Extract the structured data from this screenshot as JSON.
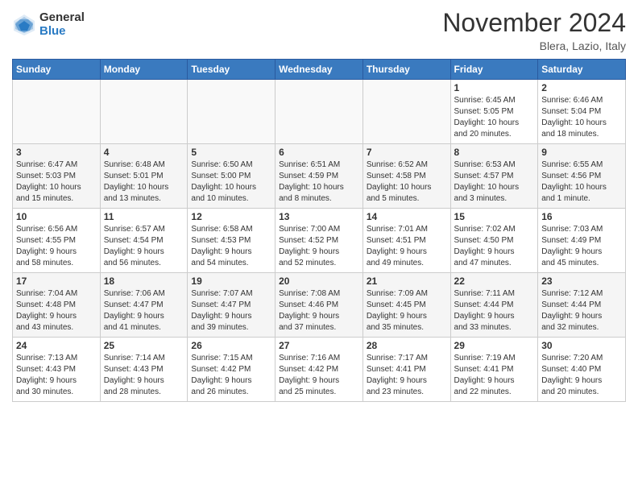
{
  "header": {
    "logo_line1": "General",
    "logo_line2": "Blue",
    "month": "November 2024",
    "location": "Blera, Lazio, Italy"
  },
  "weekdays": [
    "Sunday",
    "Monday",
    "Tuesday",
    "Wednesday",
    "Thursday",
    "Friday",
    "Saturday"
  ],
  "weeks": [
    [
      {
        "day": "",
        "info": ""
      },
      {
        "day": "",
        "info": ""
      },
      {
        "day": "",
        "info": ""
      },
      {
        "day": "",
        "info": ""
      },
      {
        "day": "",
        "info": ""
      },
      {
        "day": "1",
        "info": "Sunrise: 6:45 AM\nSunset: 5:05 PM\nDaylight: 10 hours\nand 20 minutes."
      },
      {
        "day": "2",
        "info": "Sunrise: 6:46 AM\nSunset: 5:04 PM\nDaylight: 10 hours\nand 18 minutes."
      }
    ],
    [
      {
        "day": "3",
        "info": "Sunrise: 6:47 AM\nSunset: 5:03 PM\nDaylight: 10 hours\nand 15 minutes."
      },
      {
        "day": "4",
        "info": "Sunrise: 6:48 AM\nSunset: 5:01 PM\nDaylight: 10 hours\nand 13 minutes."
      },
      {
        "day": "5",
        "info": "Sunrise: 6:50 AM\nSunset: 5:00 PM\nDaylight: 10 hours\nand 10 minutes."
      },
      {
        "day": "6",
        "info": "Sunrise: 6:51 AM\nSunset: 4:59 PM\nDaylight: 10 hours\nand 8 minutes."
      },
      {
        "day": "7",
        "info": "Sunrise: 6:52 AM\nSunset: 4:58 PM\nDaylight: 10 hours\nand 5 minutes."
      },
      {
        "day": "8",
        "info": "Sunrise: 6:53 AM\nSunset: 4:57 PM\nDaylight: 10 hours\nand 3 minutes."
      },
      {
        "day": "9",
        "info": "Sunrise: 6:55 AM\nSunset: 4:56 PM\nDaylight: 10 hours\nand 1 minute."
      }
    ],
    [
      {
        "day": "10",
        "info": "Sunrise: 6:56 AM\nSunset: 4:55 PM\nDaylight: 9 hours\nand 58 minutes."
      },
      {
        "day": "11",
        "info": "Sunrise: 6:57 AM\nSunset: 4:54 PM\nDaylight: 9 hours\nand 56 minutes."
      },
      {
        "day": "12",
        "info": "Sunrise: 6:58 AM\nSunset: 4:53 PM\nDaylight: 9 hours\nand 54 minutes."
      },
      {
        "day": "13",
        "info": "Sunrise: 7:00 AM\nSunset: 4:52 PM\nDaylight: 9 hours\nand 52 minutes."
      },
      {
        "day": "14",
        "info": "Sunrise: 7:01 AM\nSunset: 4:51 PM\nDaylight: 9 hours\nand 49 minutes."
      },
      {
        "day": "15",
        "info": "Sunrise: 7:02 AM\nSunset: 4:50 PM\nDaylight: 9 hours\nand 47 minutes."
      },
      {
        "day": "16",
        "info": "Sunrise: 7:03 AM\nSunset: 4:49 PM\nDaylight: 9 hours\nand 45 minutes."
      }
    ],
    [
      {
        "day": "17",
        "info": "Sunrise: 7:04 AM\nSunset: 4:48 PM\nDaylight: 9 hours\nand 43 minutes."
      },
      {
        "day": "18",
        "info": "Sunrise: 7:06 AM\nSunset: 4:47 PM\nDaylight: 9 hours\nand 41 minutes."
      },
      {
        "day": "19",
        "info": "Sunrise: 7:07 AM\nSunset: 4:47 PM\nDaylight: 9 hours\nand 39 minutes."
      },
      {
        "day": "20",
        "info": "Sunrise: 7:08 AM\nSunset: 4:46 PM\nDaylight: 9 hours\nand 37 minutes."
      },
      {
        "day": "21",
        "info": "Sunrise: 7:09 AM\nSunset: 4:45 PM\nDaylight: 9 hours\nand 35 minutes."
      },
      {
        "day": "22",
        "info": "Sunrise: 7:11 AM\nSunset: 4:44 PM\nDaylight: 9 hours\nand 33 minutes."
      },
      {
        "day": "23",
        "info": "Sunrise: 7:12 AM\nSunset: 4:44 PM\nDaylight: 9 hours\nand 32 minutes."
      }
    ],
    [
      {
        "day": "24",
        "info": "Sunrise: 7:13 AM\nSunset: 4:43 PM\nDaylight: 9 hours\nand 30 minutes."
      },
      {
        "day": "25",
        "info": "Sunrise: 7:14 AM\nSunset: 4:43 PM\nDaylight: 9 hours\nand 28 minutes."
      },
      {
        "day": "26",
        "info": "Sunrise: 7:15 AM\nSunset: 4:42 PM\nDaylight: 9 hours\nand 26 minutes."
      },
      {
        "day": "27",
        "info": "Sunrise: 7:16 AM\nSunset: 4:42 PM\nDaylight: 9 hours\nand 25 minutes."
      },
      {
        "day": "28",
        "info": "Sunrise: 7:17 AM\nSunset: 4:41 PM\nDaylight: 9 hours\nand 23 minutes."
      },
      {
        "day": "29",
        "info": "Sunrise: 7:19 AM\nSunset: 4:41 PM\nDaylight: 9 hours\nand 22 minutes."
      },
      {
        "day": "30",
        "info": "Sunrise: 7:20 AM\nSunset: 4:40 PM\nDaylight: 9 hours\nand 20 minutes."
      }
    ]
  ]
}
